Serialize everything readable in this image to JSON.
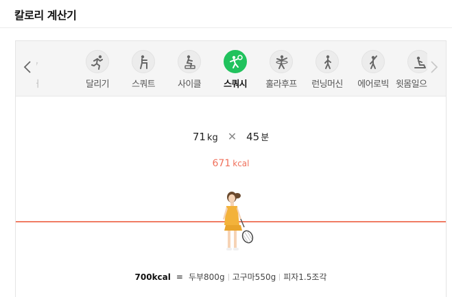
{
  "header": {
    "title": "칼로리 계산기"
  },
  "tabs": [
    {
      "label": "거",
      "icon": "partial-exercise-icon",
      "state": "ghost"
    },
    {
      "label": "달리기",
      "icon": "running-icon",
      "state": "normal"
    },
    {
      "label": "스쿼트",
      "icon": "squat-icon",
      "state": "normal"
    },
    {
      "label": "사이클",
      "icon": "cycle-icon",
      "state": "normal"
    },
    {
      "label": "스쿼시",
      "icon": "squash-icon",
      "state": "active"
    },
    {
      "label": "훌라후프",
      "icon": "hula-hoop-icon",
      "state": "normal"
    },
    {
      "label": "런닝머신",
      "icon": "treadmill-icon",
      "state": "normal"
    },
    {
      "label": "에어로빅",
      "icon": "aerobic-icon",
      "state": "normal"
    },
    {
      "label": "윗몸일으키기",
      "icon": "situp-icon",
      "state": "normal"
    }
  ],
  "calc": {
    "weight": "71",
    "weight_unit": "kg",
    "times_symbol": "✕",
    "minutes": "45",
    "minutes_unit": "분"
  },
  "result": {
    "value": "671",
    "unit": "kcal"
  },
  "equivalent": {
    "amount": "700kcal",
    "equals": "=",
    "items": [
      "두부800g",
      "고구마550g",
      "피자1.5조각"
    ]
  },
  "colors": {
    "accent": "#21c25d",
    "kcal": "#f06f5a",
    "line": "#f07a62"
  }
}
